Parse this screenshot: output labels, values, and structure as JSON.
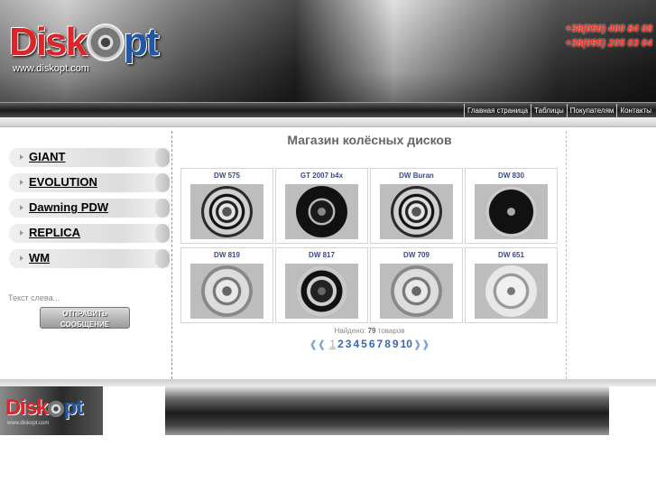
{
  "header": {
    "logo_text_red": "Disk",
    "logo_text_blue": "pt",
    "logo_url": "www.diskopt.com",
    "phones": [
      "+38(050) 400 84 08",
      "+38(095) 205 03 04"
    ]
  },
  "nav": [
    "Главная страница",
    "Таблицы",
    "Покупателям",
    "Контакты"
  ],
  "sidebar": {
    "categories": [
      "GIANT",
      "EVOLUTION",
      "Dawning PDW",
      "REPLICA",
      "WM"
    ],
    "text": "Текст слева...",
    "send_button": [
      "ОТПРАВИТЬ",
      "СООБЩЕНИЕ"
    ]
  },
  "main": {
    "title": "Магазин колёсных дисков",
    "products": [
      {
        "name": "DW 575",
        "style": "silver-black"
      },
      {
        "name": "GT 2007 b4x",
        "style": "black"
      },
      {
        "name": "DW Buran",
        "style": "silver-black"
      },
      {
        "name": "DW 830",
        "style": "black-chrome"
      },
      {
        "name": "DW 819",
        "style": "silver"
      },
      {
        "name": "DW 817",
        "style": "black-silver"
      },
      {
        "name": "DW 709",
        "style": "silver"
      },
      {
        "name": "DW 651",
        "style": "silver-light"
      }
    ],
    "found_label": "Найдено:",
    "found_count": "79",
    "found_suffix": "товаров",
    "pages": [
      "1",
      "2",
      "3",
      "4",
      "5",
      "6",
      "7",
      "8",
      "9",
      "10"
    ],
    "current_page": "1"
  },
  "footer": {
    "logo_text_red": "Disk",
    "logo_text_blue": "pt",
    "logo_url": "www.diskopt.com"
  }
}
